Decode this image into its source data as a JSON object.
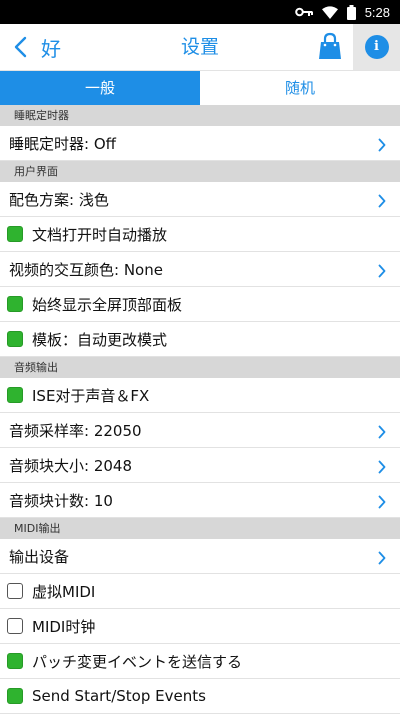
{
  "status_bar": {
    "time": "5:28"
  },
  "topbar": {
    "back_label": "好",
    "title": "设置"
  },
  "tabs": [
    {
      "label": "一般",
      "active": true
    },
    {
      "label": "随机",
      "active": false
    }
  ],
  "colors": {
    "accent": "#1e8ee6",
    "checkbox_on": "#2fb32f",
    "section_bg": "#d7d7d7"
  },
  "sections": [
    {
      "title": "睡眠定时器",
      "rows": [
        {
          "type": "nav",
          "label": "睡眠定时器: Off"
        }
      ]
    },
    {
      "title": "用户界面",
      "rows": [
        {
          "type": "nav",
          "label": "配色方案: 浅色"
        },
        {
          "type": "check",
          "label": "文档打开时自动播放",
          "checked": true
        },
        {
          "type": "nav",
          "label": "视频的交互颜色: None"
        },
        {
          "type": "check",
          "label": "始终显示全屏顶部面板",
          "checked": true
        },
        {
          "type": "check",
          "label": "模板：自动更改模式",
          "checked": true
        }
      ]
    },
    {
      "title": "音频输出",
      "rows": [
        {
          "type": "check",
          "label": "ISE对于声音＆FX",
          "checked": true
        },
        {
          "type": "nav",
          "label": "音频采样率: 22050"
        },
        {
          "type": "nav",
          "label": "音频块大小: 2048"
        },
        {
          "type": "nav",
          "label": "音频块计数: 10"
        }
      ]
    },
    {
      "title": "MIDI输出",
      "rows": [
        {
          "type": "nav",
          "label": "输出设备"
        },
        {
          "type": "check",
          "label": "虚拟MIDI",
          "checked": false
        },
        {
          "type": "check",
          "label": "MIDI时钟",
          "checked": false
        },
        {
          "type": "check",
          "label": "パッチ変更イベントを送信する",
          "checked": true
        },
        {
          "type": "check",
          "label": "Send Start/Stop Events",
          "checked": true
        }
      ]
    }
  ]
}
